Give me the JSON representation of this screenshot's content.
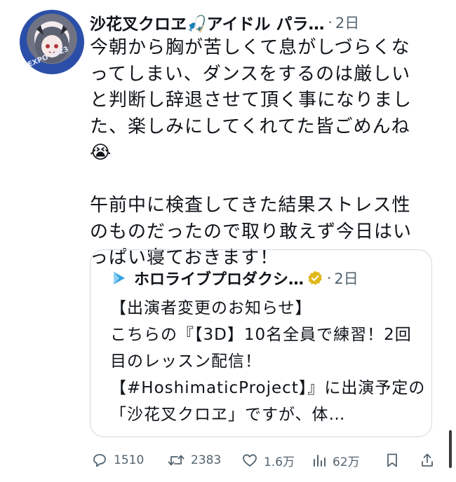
{
  "post": {
    "display_name": "沙花叉クロヱ🎣アイドル パラ…",
    "separator": "·",
    "timestamp": "2日",
    "avatar_text": "EXPO 2023",
    "body": "今朝から胸が苦しくて息がしづらくなってしまい、ダンスをするのは厳しいと判断し辞退させて頂く事になりました、楽しみにしてくれてた皆ごめんね😭\n\n午前中に検査してきた結果ストレス性のものだったので取り敢えず今日はいっぱい寝ておきます！"
  },
  "quote": {
    "name": "ホロライブプロダクシ…",
    "separator": "·",
    "timestamp": "2日",
    "text": "【出演者変更のお知らせ】\nこちらの『【3D】10名全員で練習！2回目のレッスン配信！【#HoshimaticProject】』に出演予定の「沙花叉クロヱ」ですが、体…"
  },
  "actions": {
    "replies": "1510",
    "reposts": "2383",
    "likes": "1.6万",
    "views": "62万"
  },
  "colors": {
    "text": "#0f1419",
    "muted": "#536471",
    "border": "#cfd9de",
    "verified_gold": "#e2b719",
    "logo_blue": "#36a3e0"
  },
  "icons": [
    "reply-icon",
    "repost-icon",
    "like-icon",
    "views-icon",
    "bookmark-icon",
    "share-icon",
    "verified-gold-badge-icon",
    "hololive-logo-icon"
  ]
}
